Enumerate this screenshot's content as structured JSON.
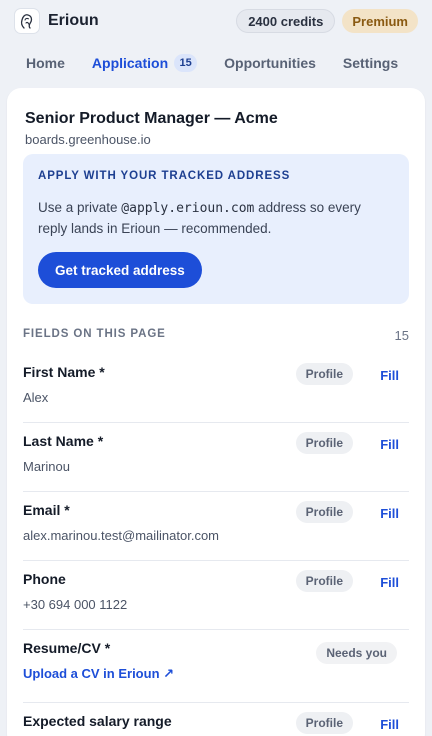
{
  "header": {
    "brand": "Erioun",
    "credits": "2400 credits",
    "premium": "Premium"
  },
  "tabs": [
    {
      "label": "Home",
      "active": false
    },
    {
      "label": "Application",
      "badge": "15",
      "active": true
    },
    {
      "label": "Opportunities",
      "active": false
    },
    {
      "label": "Settings",
      "active": false
    }
  ],
  "job": {
    "title": "Senior Product Manager — Acme",
    "source": "boards.greenhouse.io"
  },
  "promo": {
    "heading": "APPLY WITH YOUR TRACKED ADDRESS",
    "text_before": "Use a private ",
    "address": "@apply.erioun.com",
    "text_after": " address so every reply lands in Erioun — recommended.",
    "button": "Get tracked address"
  },
  "fields_section": {
    "heading": "FIELDS ON THIS PAGE",
    "count": "15"
  },
  "fields": [
    {
      "label": "First Name",
      "required": " *",
      "value": "Alex",
      "badge": "Profile",
      "action": "Fill"
    },
    {
      "label": "Last Name",
      "required": " *",
      "value": "Marinou",
      "badge": "Profile",
      "action": "Fill"
    },
    {
      "label": "Email",
      "required": " *",
      "value": "alex.marinou.test@mailinator.com",
      "badge": "Profile",
      "action": "Fill"
    },
    {
      "label": "Phone",
      "required": "",
      "value": "+30 694 000 1122",
      "badge": "Profile",
      "action": "Fill"
    },
    {
      "label": "Resume/CV",
      "required": " *",
      "link": "Upload a CV in Erioun ↗",
      "badge": "Needs you"
    },
    {
      "label": "Expected salary range",
      "required": "",
      "value": "",
      "badge": "Profile",
      "action": "Fill"
    }
  ],
  "colors": {
    "accent": "#1d4ed8",
    "premium_bg": "#f3e3c7",
    "premium_text": "#8a5a12",
    "promo_bg": "#e8effd"
  }
}
